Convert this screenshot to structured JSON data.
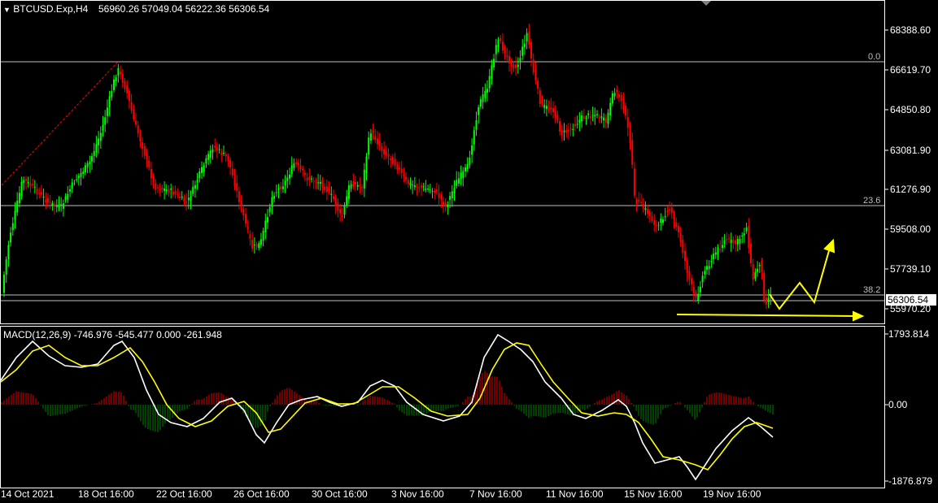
{
  "header": {
    "symbol": "BTCUSD.Exp,H4",
    "ohlc": "56960.26 57049.04 56222.36 56306.54"
  },
  "price_axis": {
    "labels": [
      "68388.60",
      "66619.70",
      "64850.80",
      "63081.90",
      "61276.90",
      "59508.00",
      "57739.10",
      "55970.20"
    ],
    "current_price": "56306.54"
  },
  "fibonacci": {
    "levels": [
      "0.0",
      "23.6",
      "38.2"
    ]
  },
  "macd": {
    "title": "MACD(12,26,9) -746.976 -545.477 0.000 -261.948",
    "axis_labels": [
      "1793.814",
      "0.00",
      "-1876.879"
    ]
  },
  "time_axis": {
    "labels": [
      "14 Oct 2021",
      "18 Oct 16:00",
      "22 Oct 16:00",
      "26 Oct 16:00",
      "30 Oct 16:00",
      "3 Nov 16:00",
      "7 Nov 16:00",
      "11 Nov 16:00",
      "15 Nov 16:00",
      "19 Nov 16:00"
    ]
  },
  "colors": {
    "bull": "#00ff00",
    "bear": "#ff0000",
    "grid_line": "#c0c0c0",
    "annotation": "#ffff00",
    "macd_main": "#ffffff",
    "macd_signal": "#ffff00"
  }
}
